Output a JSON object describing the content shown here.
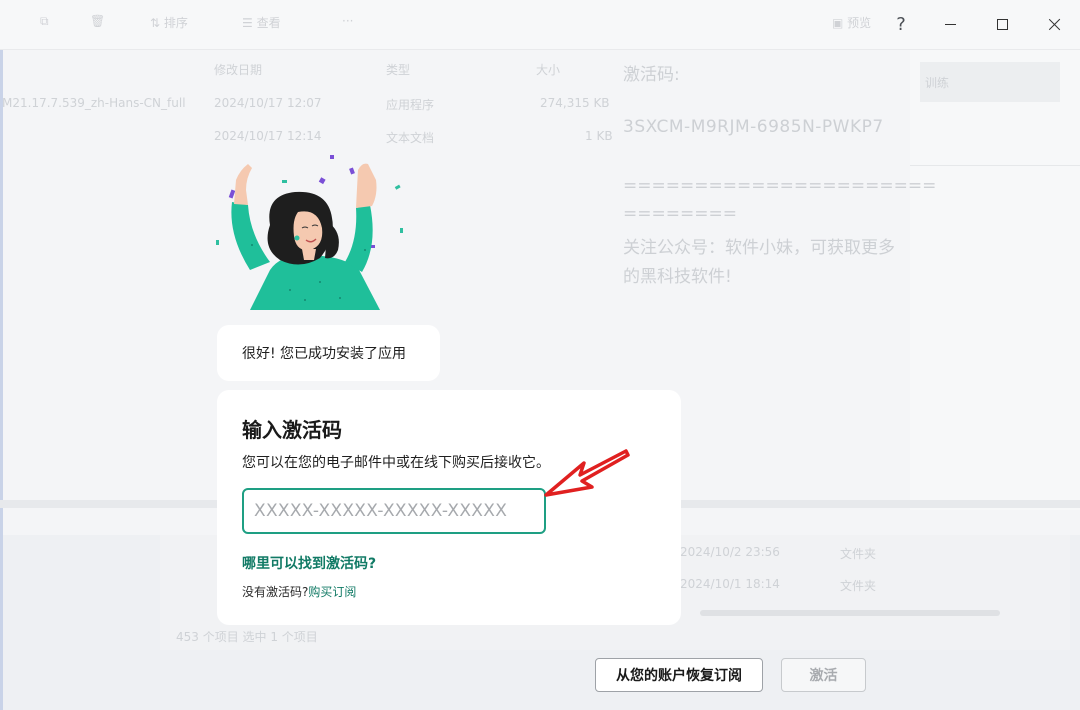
{
  "background_app": {
    "toolbar": {
      "sort_label": "排序",
      "view_label": "查看",
      "more_label": "···",
      "preview_label": "预览"
    },
    "columns": [
      "修改日期",
      "类型",
      "大小"
    ],
    "file_row_1": {
      "name": "M21.17.7.539_zh-Hans-CN_full",
      "date": "2024/10/17 12:07",
      "type": "应用程序",
      "size": "274,315 KB"
    },
    "file_row_2": {
      "date": "2024/10/17 12:14",
      "type": "文本文档",
      "size": "1 KB"
    },
    "right_chip_label": "训练",
    "lower_rows": [
      {
        "date": "2024/10/2 23:56",
        "type": "文件夹"
      },
      {
        "date": "2024/10/1 18:14",
        "type": "文件夹"
      }
    ],
    "status_bar": "453 个项目    选中 1 个项目"
  },
  "notepad": {
    "label": "激活码:",
    "key": "3SXCM-M9RJM-6985N-PWKP7",
    "separator_1": "======================",
    "separator_2": "========",
    "note_1": "关注公众号：软件小妹，可获取更多",
    "note_2": "的黑科技软件!"
  },
  "window": {
    "help_label": "?"
  },
  "success_message": "很好! 您已成功安装了应用",
  "activation": {
    "title": "输入激活码",
    "description": "您可以在您的电子邮件中或在线下购买后接收它。",
    "input_placeholder": "XXXXX-XXXXX-XXXXX-XXXXX",
    "input_value": "",
    "find_link": "哪里可以找到激活码?",
    "no_code_text": "没有激活码?",
    "buy_link": "购买订阅"
  },
  "buttons": {
    "restore": "从您的账户恢复订阅",
    "activate": "激活"
  },
  "colors": {
    "accent_green": "#1e9f83",
    "link_green": "#117a65",
    "arrow_red": "#e02020"
  }
}
